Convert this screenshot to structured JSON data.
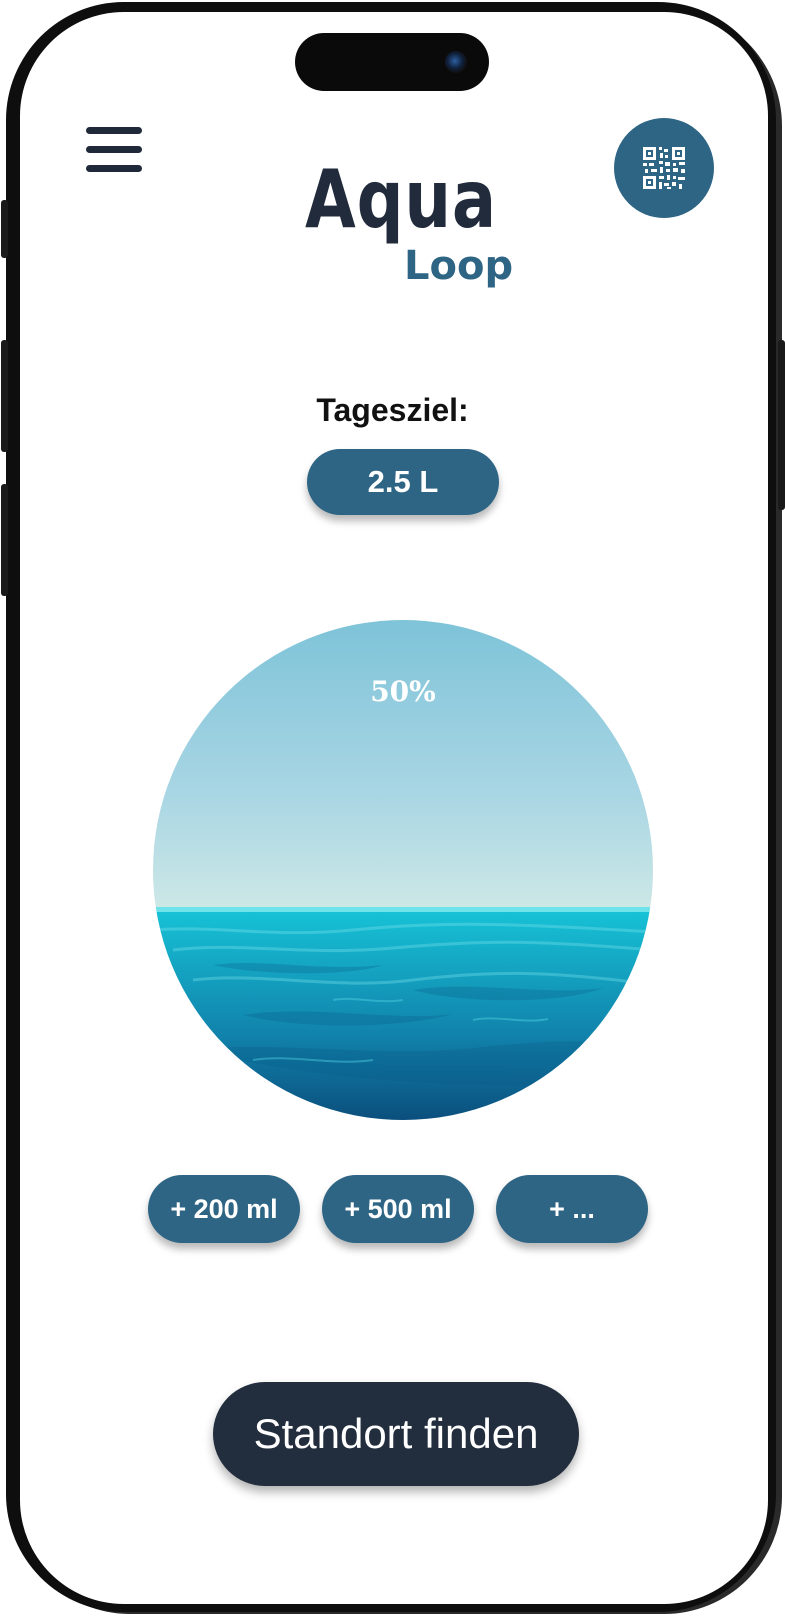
{
  "app": {
    "logo_primary": "Aqua",
    "logo_secondary": "Loop"
  },
  "header": {
    "menu_icon": "hamburger-menu-icon",
    "qr_icon": "qr-code-icon"
  },
  "goal": {
    "label": "Tagesziel:",
    "value": "2.5 L"
  },
  "progress": {
    "percent_label": "50%",
    "fill_fraction": 0.5
  },
  "quick_add": [
    {
      "label": "+ 200 ml"
    },
    {
      "label": "+ 500 ml"
    },
    {
      "label": "+ ..."
    }
  ],
  "cta": {
    "label": "Standort finden"
  },
  "colors": {
    "accent": "#2e6585",
    "dark": "#222d3d",
    "sky_top": "#7ec3d8",
    "water_mid": "#1ab4cc",
    "water_deep": "#0d5b86"
  }
}
